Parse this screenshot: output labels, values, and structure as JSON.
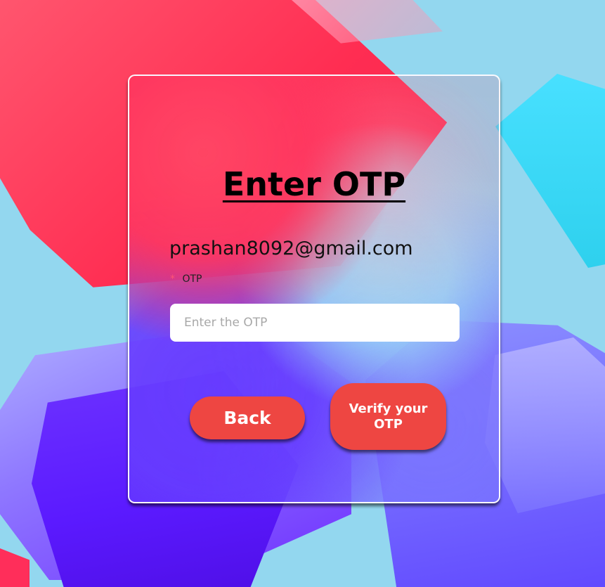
{
  "colors": {
    "background": "#93d7ef",
    "card_border": "#ffffff",
    "button": "#ee4642",
    "required_indicator": "#ff5573"
  },
  "otp_page": {
    "title": "Enter OTP",
    "email": "prashan8092@gmail.com",
    "otp_label": "OTP",
    "otp_input": {
      "value": "",
      "placeholder": "Enter the OTP"
    },
    "back_button_label": "Back",
    "verify_button_label": "Verify your OTP"
  }
}
